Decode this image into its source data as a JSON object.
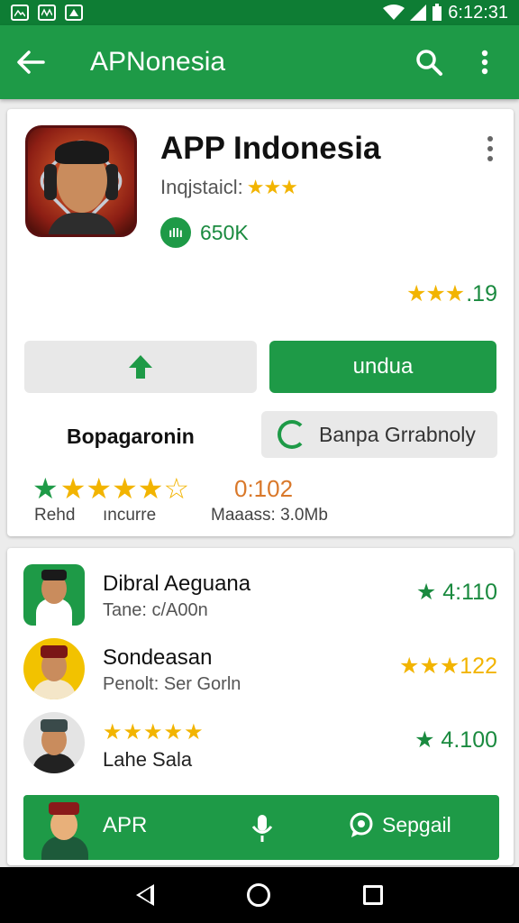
{
  "status_bar": {
    "time": "6:12:31",
    "icons": [
      "image-icon",
      "media-icon",
      "app-icon",
      "wifi-icon",
      "signal-icon",
      "battery-icon"
    ]
  },
  "app_bar": {
    "title": "APNonesia",
    "back_icon": "arrow-back-icon",
    "search_icon": "search-icon",
    "menu_icon": "more-vert-icon"
  },
  "app_card": {
    "title": "APP Indonesia",
    "developer": "Inqjstaicl:",
    "developer_stars": "★★★",
    "downloads_badge": "ıllı",
    "downloads": "650K",
    "rating_stars": "★★★",
    "rating_value": ".19",
    "secondary_button_icon": "arrow-up-icon",
    "install_button": "undua",
    "left_label": "Bopagaronin",
    "outline_button": "Banpa Grrabnoly",
    "stat_stars": "★★★★☆",
    "stat_count": "0:102",
    "stat_labels": [
      "Rehd",
      "ıncurre",
      "Maaass: 3.0Mb"
    ]
  },
  "list": [
    {
      "title": "Dibral Aeguana",
      "subtitle": "Tane: c/A00n",
      "rating": "★ 4:110"
    },
    {
      "title": "Sondeasan",
      "subtitle": "Penolt: Ser Gorln",
      "rating": "★★★122"
    },
    {
      "title": "★★★★★",
      "subtitle": "Lahe Sala",
      "rating": "★ 4.100"
    }
  ],
  "bottom_banner": {
    "title": "APR",
    "mic_icon": "mic-icon",
    "button_label": "Sepgail",
    "button_icon": "chat-icon"
  },
  "nav_bar": {
    "back": "back-icon",
    "home": "home-icon",
    "recents": "recents-icon"
  },
  "colors": {
    "primary": "#1e9a47",
    "status_bar": "#0e7d34",
    "star": "#f2b400",
    "stat_count": "#d9782a"
  }
}
